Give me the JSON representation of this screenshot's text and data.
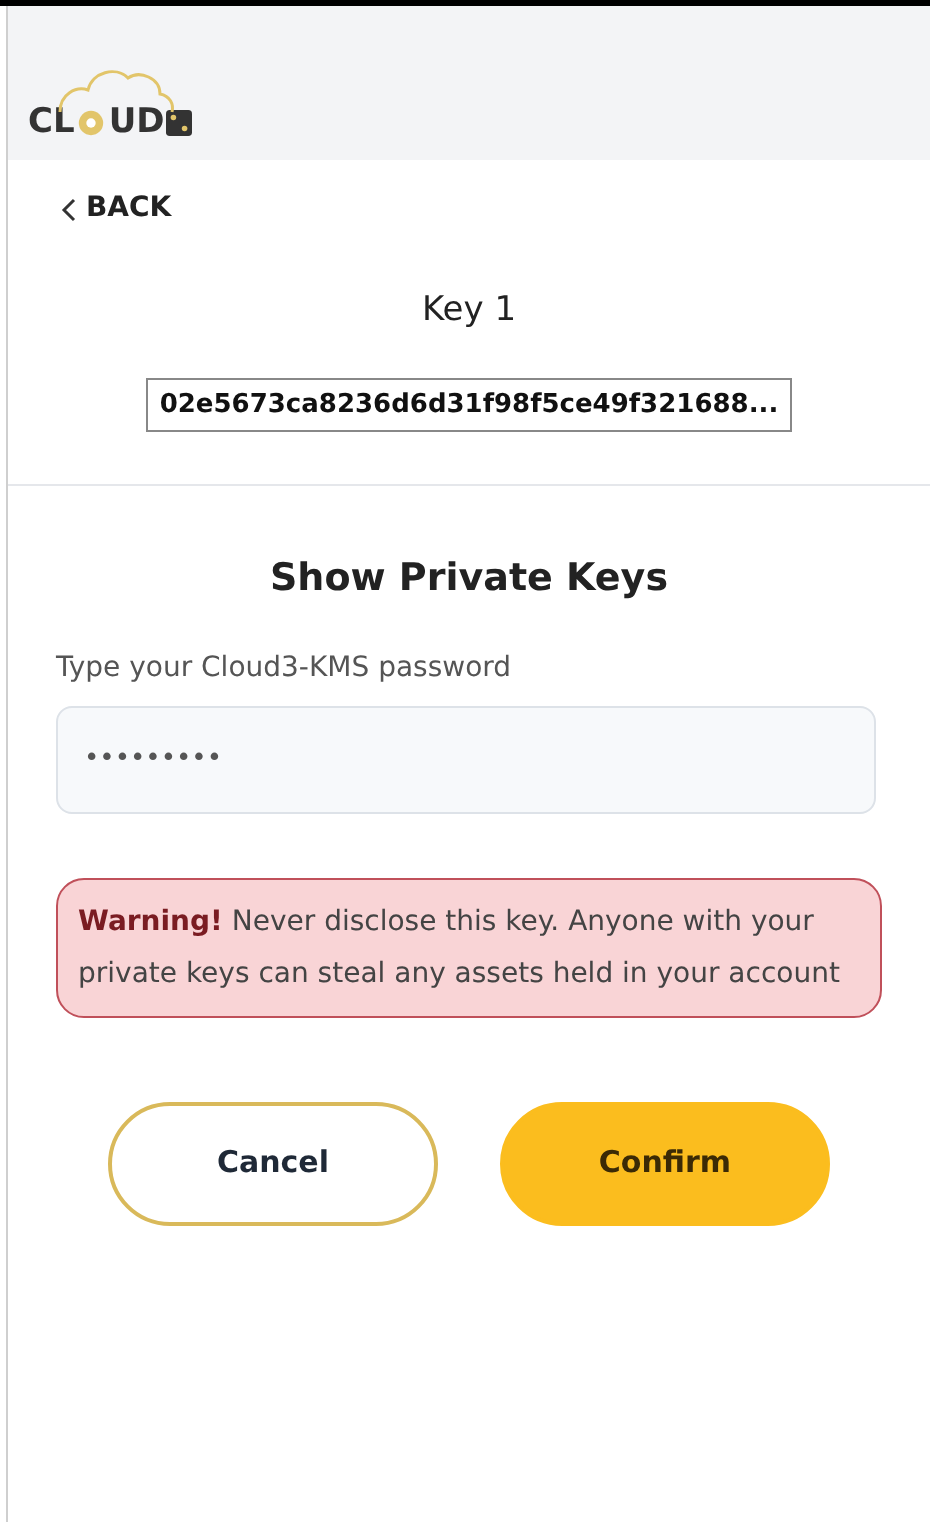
{
  "logo": {
    "text_start": "CL",
    "text_end": "UD"
  },
  "back_link": {
    "label": "BACK"
  },
  "key": {
    "title": "Key 1",
    "value": "02e5673ca8236d6d31f98f5ce49f321688..."
  },
  "private_keys": {
    "title": "Show Private Keys",
    "password_label": "Type your Cloud3-KMS password",
    "password_value": "•••••••••"
  },
  "warning": {
    "text": "**Warning!** Never disclose this key. Anyone with your private keys can steal any assets held in your account"
  },
  "buttons": [
    {
      "kind": "outline",
      "label": "Cancel"
    },
    {
      "kind": "primary",
      "label": "Confirm"
    }
  ]
}
